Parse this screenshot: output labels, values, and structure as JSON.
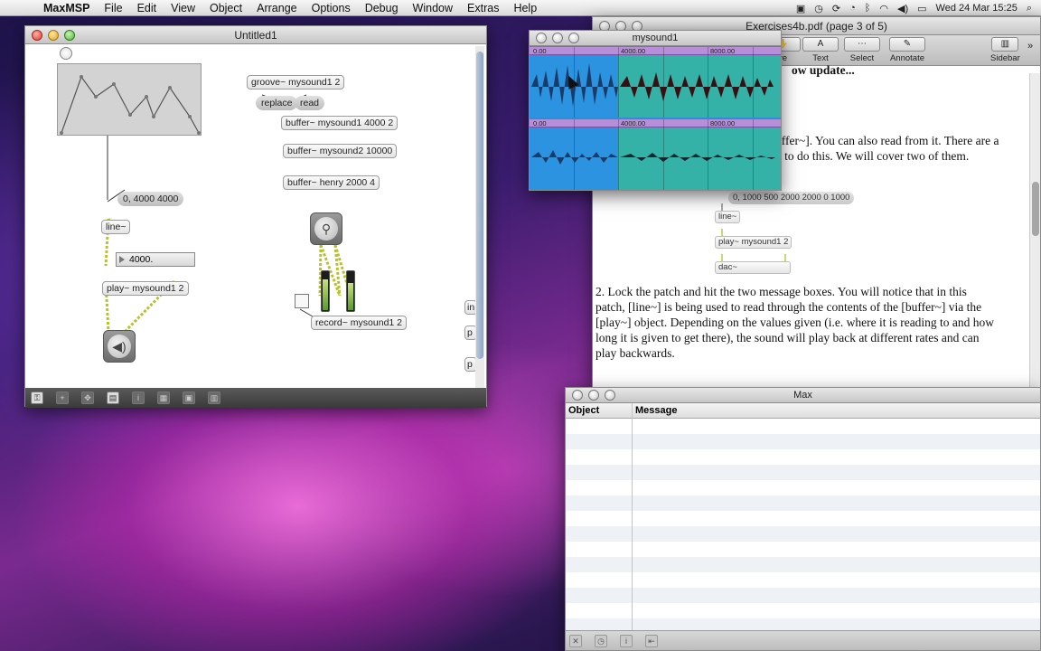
{
  "menubar": {
    "app": "MaxMSP",
    "items": [
      "File",
      "Edit",
      "View",
      "Object",
      "Arrange",
      "Options",
      "Debug",
      "Window",
      "Extras",
      "Help"
    ],
    "clock": "Wed 24 Mar  15:25"
  },
  "patch": {
    "title": "Untitled1",
    "objects": {
      "groove": "groove~ mysound1 2",
      "replace": "replace",
      "read": "read",
      "buffer1": "buffer~ mysound1 4000 2",
      "buffer2": "buffer~ mysound2 10000",
      "buffer3": "buffer~ henry 2000 4",
      "line_msg": "0, 4000 4000",
      "line": "line~",
      "numbox": "4000.",
      "play": "play~ mysound1 2",
      "record": "record~ mysound1 2",
      "edge_labels": [
        "in",
        "p",
        "p"
      ]
    }
  },
  "sound_window": {
    "title": "mysound1",
    "ruler_marks": [
      "0.00",
      "4000.00",
      "8000.00"
    ]
  },
  "pdf": {
    "title": "Exercises4b.pdf (page 3 of 5)",
    "toolbar": [
      {
        "label": "ve",
        "icon": "move-icon"
      },
      {
        "label": "Text",
        "icon": "text-icon"
      },
      {
        "label": "Select",
        "icon": "select-icon"
      },
      {
        "label": "Annotate",
        "icon": "annotate-icon"
      },
      {
        "label": "Sidebar",
        "icon": "sidebar-icon"
      }
    ],
    "heading_fragment": "ow update...",
    "para1_line1": "uffer~]. You can also read from it. There are a",
    "para1_line2": "u to do this. We will cover two of them.",
    "diagram": {
      "msg": "0, 1000 500 2000 2000 0 1000",
      "line": "line~",
      "play": "play~ mysound1 2",
      "dac": "dac~"
    },
    "para2": [
      "2. Lock the patch and hit the two message boxes. You will notice that in this",
      "patch, [line~] is being used to read through the contents of the [buffer~] via the",
      "[play~] object. Depending on the values given (i.e. where it is reading to and how",
      "long it is given to get there), the sound will play back at different rates and can",
      "play backwards."
    ]
  },
  "console": {
    "title": "Max",
    "col_object": "Object",
    "col_message": "Message"
  },
  "colors": {
    "patchcord_signal": "#b5c22c",
    "sound_selected": "#2b93df",
    "sound_unselected": "#35b2a8",
    "ruler": "#b78fd8"
  }
}
